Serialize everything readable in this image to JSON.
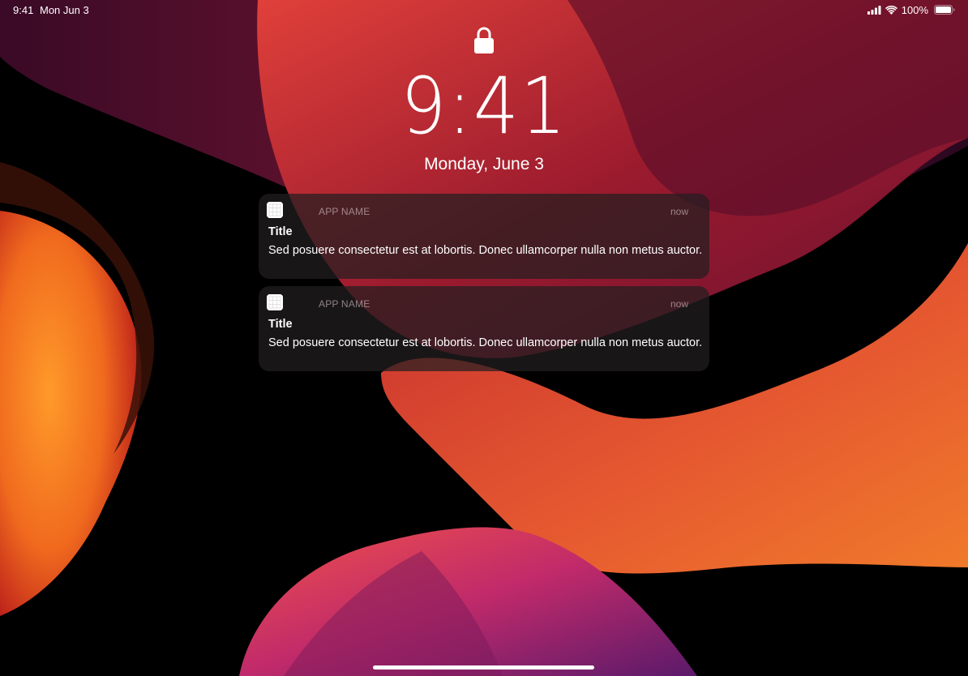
{
  "status_bar": {
    "time": "9:41",
    "date": "Mon Jun 3",
    "battery": "100%",
    "signal_icon": "cellular-signal-icon",
    "wifi_icon": "wifi-icon",
    "battery_icon": "battery-icon"
  },
  "lock_screen": {
    "lock_icon": "lock-icon",
    "clock": "9:41",
    "date": "Monday, June 3"
  },
  "notifications": [
    {
      "app_name": "APP NAME",
      "time": "now",
      "title": "Title",
      "body": "Sed posuere consectetur est at lobortis. Donec ullamcorper nulla non metus auctor."
    },
    {
      "app_name": "APP NAME",
      "time": "now",
      "title": "Title",
      "body": "Sed posuere consectetur est at lobortis. Donec ullamcorper nulla non metus auctor."
    }
  ],
  "colors": {
    "wallpaper_dark": "#000000",
    "wallpaper_red": "#8e1c2c",
    "wallpaper_orange": "#f07a2a",
    "notification_bg": "#231e20",
    "text": "#ffffff"
  }
}
